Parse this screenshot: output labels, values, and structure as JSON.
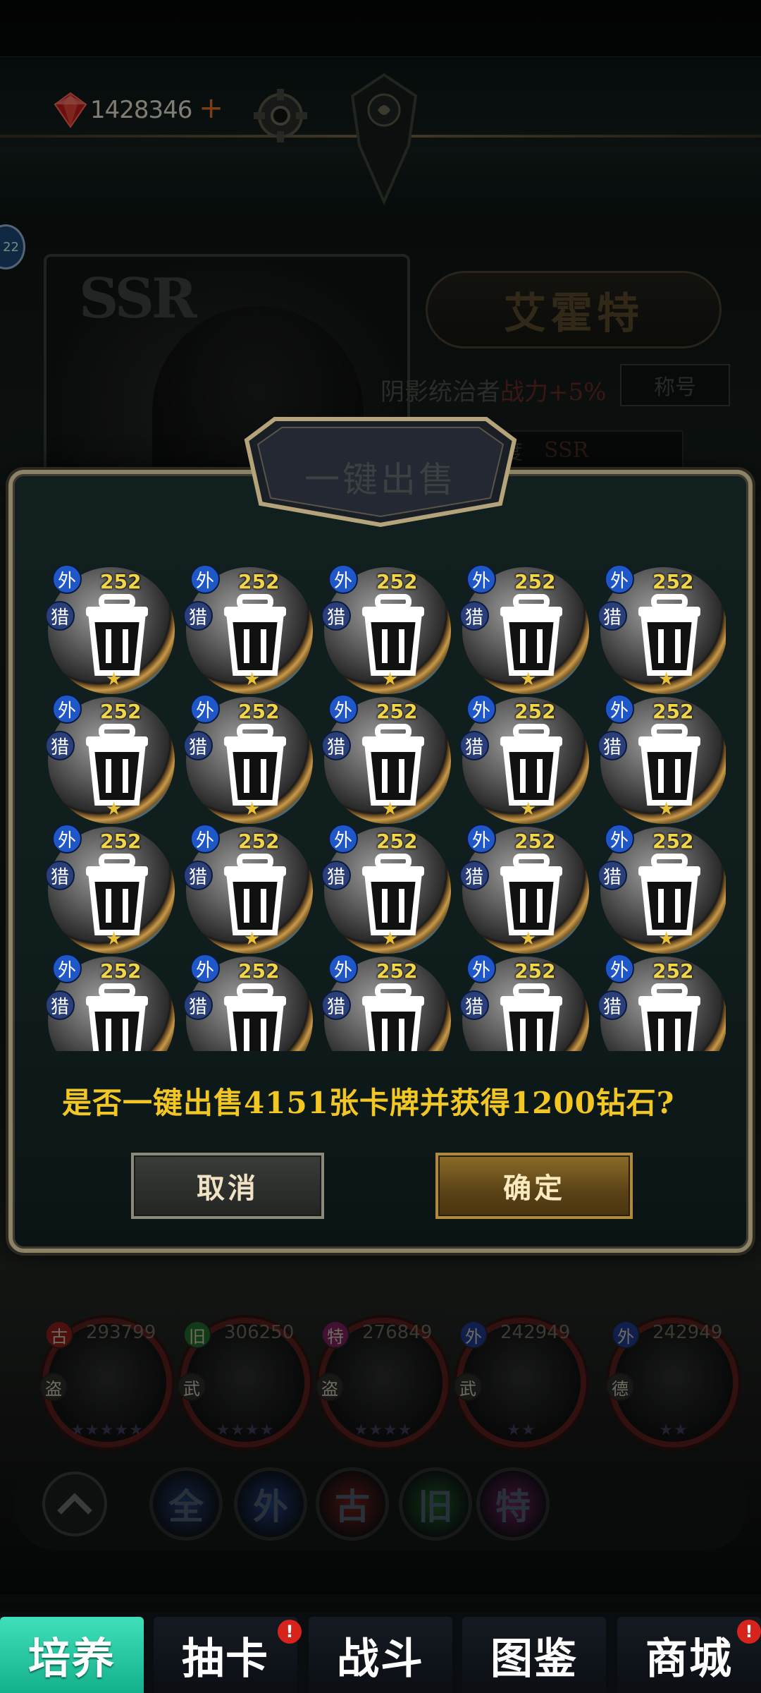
{
  "status": {
    "diamond_count": "1428346",
    "add_label": "+",
    "side_badge": "22"
  },
  "hero": {
    "rarity": "SSR",
    "name": "艾霍特",
    "subtitle": "阴影统治者",
    "bonus": "战力+5%",
    "title_button": "称号",
    "grade_label": "度",
    "grade_value": "SSR"
  },
  "dialog": {
    "title": "一键出售",
    "cards": [
      {
        "power": "252",
        "tag_top": "外",
        "tag_side": "猎"
      },
      {
        "power": "252",
        "tag_top": "外",
        "tag_side": "猎"
      },
      {
        "power": "252",
        "tag_top": "外",
        "tag_side": "猎"
      },
      {
        "power": "252",
        "tag_top": "外",
        "tag_side": "猎"
      },
      {
        "power": "252",
        "tag_top": "外",
        "tag_side": "猎"
      },
      {
        "power": "252",
        "tag_top": "外",
        "tag_side": "猎"
      },
      {
        "power": "252",
        "tag_top": "外",
        "tag_side": "猎"
      },
      {
        "power": "252",
        "tag_top": "外",
        "tag_side": "猎"
      },
      {
        "power": "252",
        "tag_top": "外",
        "tag_side": "猎"
      },
      {
        "power": "252",
        "tag_top": "外",
        "tag_side": "猎"
      },
      {
        "power": "252",
        "tag_top": "外",
        "tag_side": "猎"
      },
      {
        "power": "252",
        "tag_top": "外",
        "tag_side": "猎"
      },
      {
        "power": "252",
        "tag_top": "外",
        "tag_side": "猎"
      },
      {
        "power": "252",
        "tag_top": "外",
        "tag_side": "猎"
      },
      {
        "power": "252",
        "tag_top": "外",
        "tag_side": "猎"
      },
      {
        "power": "252",
        "tag_top": "外",
        "tag_side": "猎"
      },
      {
        "power": "252",
        "tag_top": "外",
        "tag_side": "猎"
      },
      {
        "power": "252",
        "tag_top": "外",
        "tag_side": "猎"
      },
      {
        "power": "252",
        "tag_top": "外",
        "tag_side": "猎"
      },
      {
        "power": "252",
        "tag_top": "外",
        "tag_side": "猎"
      }
    ],
    "confirm_text": "是否一键出售4151张卡牌并获得1200钻石?",
    "cancel_label": "取消",
    "ok_label": "确定"
  },
  "collection": [
    {
      "power": "293799",
      "tag_top": "古",
      "tag_side": "盗",
      "stars": "★★★★★",
      "tag_color": "#8a1f1a"
    },
    {
      "power": "306250",
      "tag_top": "旧",
      "tag_side": "武",
      "stars": "★★★★",
      "tag_color": "#1f6a2a"
    },
    {
      "power": "276849",
      "tag_top": "特",
      "tag_side": "盗",
      "stars": "★★★★",
      "tag_color": "#7a1f5a"
    },
    {
      "power": "242949",
      "tag_top": "外",
      "tag_side": "武",
      "stars": "★★",
      "tag_color": "#1f3a8a"
    },
    {
      "power": "242949",
      "tag_top": "外",
      "tag_side": "德",
      "stars": "★★",
      "tag_color": "#1f3a8a"
    }
  ],
  "filters": [
    {
      "label": "全",
      "color": "#1f3a6a"
    },
    {
      "label": "外",
      "color": "#1f3a7a"
    },
    {
      "label": "古",
      "color": "#6a1f1a"
    },
    {
      "label": "旧",
      "color": "#1f5a2a"
    },
    {
      "label": "特",
      "color": "#6a1f5a"
    }
  ],
  "nav": {
    "tabs": [
      {
        "label": "培养",
        "active": true,
        "badge": ""
      },
      {
        "label": "抽卡",
        "active": false,
        "badge": "!"
      },
      {
        "label": "战斗",
        "active": false,
        "badge": ""
      },
      {
        "label": "图鉴",
        "active": false,
        "badge": ""
      },
      {
        "label": "商城",
        "active": false,
        "badge": "!"
      }
    ]
  },
  "colors": {
    "accent_gold": "#f2c623",
    "power_yellow": "#f2d64a",
    "active_tab": "#2cc8a2",
    "badge_red": "#d6231c"
  }
}
